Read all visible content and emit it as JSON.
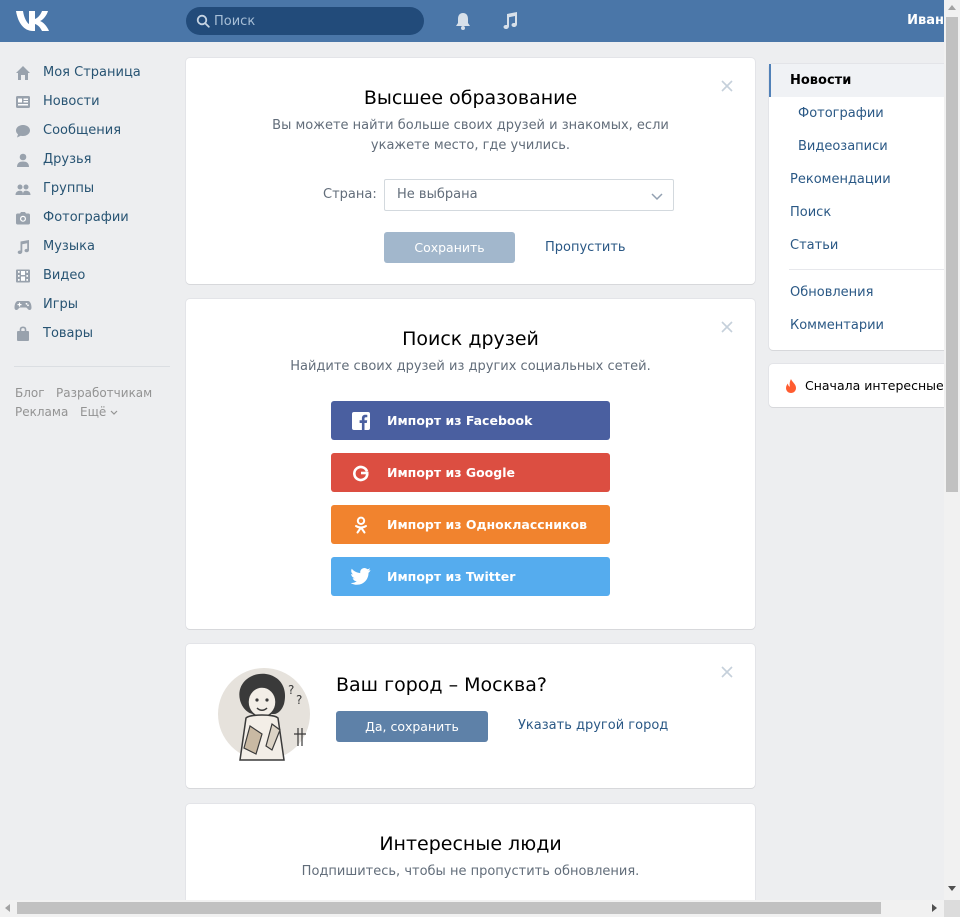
{
  "header": {
    "logo": "vk-logo",
    "search_placeholder": "Поиск",
    "username": "Иван"
  },
  "leftnav": {
    "items": [
      {
        "label": "Моя Страница",
        "icon": "home-icon"
      },
      {
        "label": "Новости",
        "icon": "news-icon"
      },
      {
        "label": "Сообщения",
        "icon": "messages-icon"
      },
      {
        "label": "Друзья",
        "icon": "friend-icon"
      },
      {
        "label": "Группы",
        "icon": "groups-icon"
      },
      {
        "label": "Фотографии",
        "icon": "camera-icon"
      },
      {
        "label": "Музыка",
        "icon": "music-icon"
      },
      {
        "label": "Видео",
        "icon": "video-icon"
      },
      {
        "label": "Игры",
        "icon": "gamepad-icon"
      },
      {
        "label": "Товары",
        "icon": "bag-icon"
      }
    ],
    "footer": {
      "blog": "Блог",
      "developers": "Разработчикам",
      "ads": "Реклама",
      "more": "Ещё"
    }
  },
  "education_card": {
    "title": "Высшее образование",
    "subtitle_line1": "Вы можете найти больше своих друзей и знакомых, если",
    "subtitle_line2": "укажете место, где учились.",
    "country_label": "Страна:",
    "country_value": "Не выбрана",
    "save_label": "Сохранить",
    "skip_label": "Пропустить"
  },
  "friends_card": {
    "title": "Поиск друзей",
    "subtitle": "Найдите своих друзей из других социальных сетей.",
    "buttons": [
      {
        "label": "Импорт из Facebook",
        "color": "#4a5fa0",
        "icon": "facebook-icon"
      },
      {
        "label": "Импорт из Google",
        "color": "#dc4e41",
        "icon": "google-icon"
      },
      {
        "label": "Импорт из Одноклассников",
        "color": "#f1832e",
        "icon": "odnoklassniki-icon"
      },
      {
        "label": "Импорт из Twitter",
        "color": "#55acee",
        "icon": "twitter-icon"
      }
    ]
  },
  "city_card": {
    "title": "Ваш город – Москва?",
    "confirm_label": "Да, сохранить",
    "other_label": "Указать другой город"
  },
  "people_card": {
    "title": "Интересные люди",
    "subtitle": "Подпишитесь, чтобы не пропустить обновления."
  },
  "right_menu": {
    "items": [
      {
        "label": "Новости",
        "active": true
      },
      {
        "label": "Фотографии",
        "sub": true
      },
      {
        "label": "Видеозаписи",
        "sub": true
      },
      {
        "label": "Рекомендации"
      },
      {
        "label": "Поиск"
      },
      {
        "label": "Статьи"
      },
      {
        "label": "Обновления"
      },
      {
        "label": "Комментарии"
      }
    ],
    "interesting_first": "Сначала интересные"
  },
  "colors": {
    "header": "#4a76a8",
    "link": "#2a5885",
    "fire": "#ff5c30"
  }
}
